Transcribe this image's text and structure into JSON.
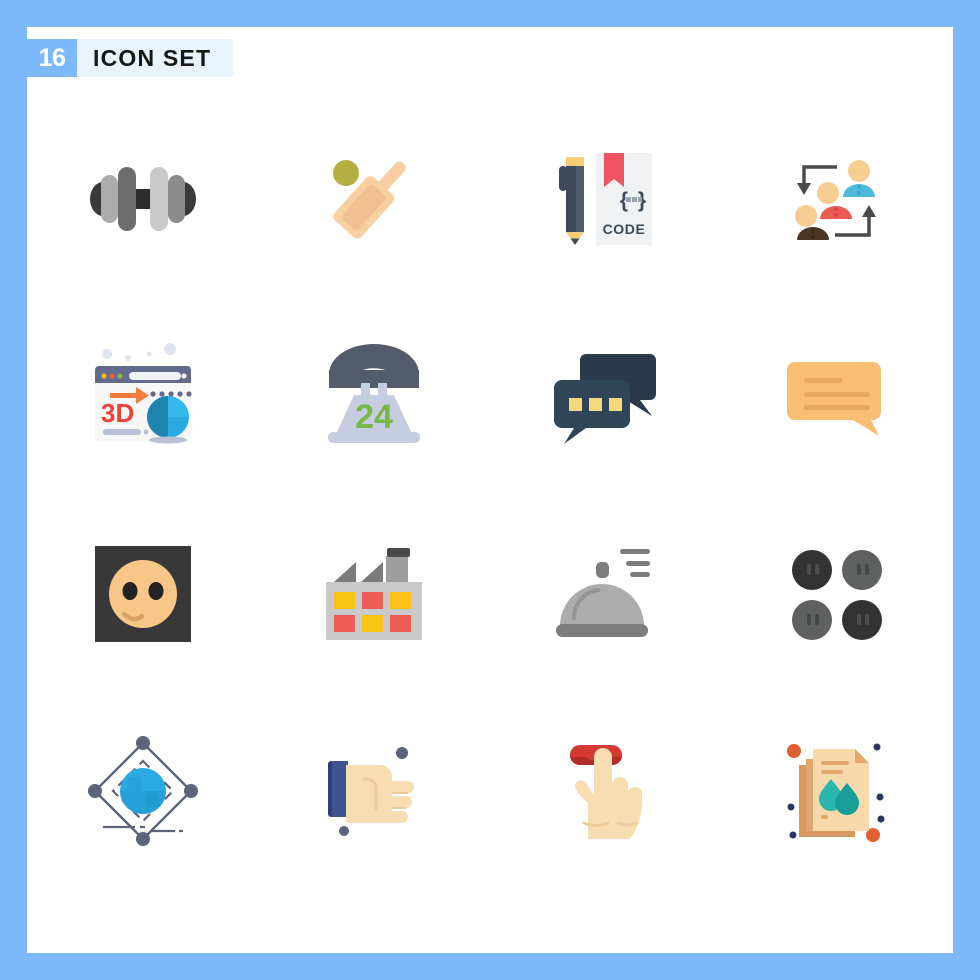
{
  "page": {
    "background_color": "#7db8fb",
    "canvas_color": "#ffffff"
  },
  "header": {
    "count": "16",
    "title": "ICON SET",
    "count_bg": "#7db8fb",
    "title_bg": "#eaf3fd",
    "count_color": "#ffffff",
    "title_color": "#161616"
  },
  "grid": {
    "columns": 4,
    "rows": 4,
    "total_icons": 16
  },
  "icons": [
    {
      "index": 1,
      "name": "dumbbell",
      "label": "Dumbbell",
      "colors": [
        "#3a3a3a",
        "#6e6e6e",
        "#a8a8a8",
        "#c9c9c9"
      ]
    },
    {
      "index": 2,
      "name": "cricket-bat",
      "label": "Cricket Bat and Ball",
      "colors": [
        "#f8cfa0",
        "#f5be82",
        "#b5ae42"
      ]
    },
    {
      "index": 3,
      "name": "coding-book",
      "label": "Code Book and Pen",
      "text": "CODE",
      "braces": "{...}",
      "colors": [
        "#3e4a5a",
        "#f0f1f3",
        "#ef5261",
        "#f4cf78"
      ]
    },
    {
      "index": 4,
      "name": "team-hierarchy",
      "label": "Team Hierarchy",
      "colors": [
        "#4cbadd",
        "#ea5a52",
        "#4c3524",
        "#f8cd92",
        "#4a4a4a"
      ]
    },
    {
      "index": 5,
      "name": "three-d-web",
      "label": "3D Web Browser",
      "text": "3D",
      "colors": [
        "#f7f7f7",
        "#646a8c",
        "#ef4136",
        "#f07c3e",
        "#1d85b0",
        "#29abe2"
      ]
    },
    {
      "index": 6,
      "name": "support-24-phone",
      "label": "24 Hour Phone Support",
      "text": "24",
      "colors": [
        "#545b6b",
        "#c6cde0",
        "#7ab648"
      ]
    },
    {
      "index": 7,
      "name": "chat-bubbles",
      "label": "Chat Conversation",
      "colors": [
        "#2b3a4a",
        "#314558",
        "#f6d87d"
      ]
    },
    {
      "index": 8,
      "name": "message-bubble",
      "label": "Message Bubble",
      "colors": [
        "#f9bd74",
        "#e7a75e"
      ]
    },
    {
      "index": 9,
      "name": "smiley-face",
      "label": "Emoji Face",
      "colors": [
        "#383838",
        "#f8c686",
        "#232323",
        "#d9a263"
      ]
    },
    {
      "index": 10,
      "name": "factory",
      "label": "Factory",
      "colors": [
        "#c9c9c9",
        "#7b7b7b",
        "#4a4a4a",
        "#fbc316",
        "#ef5b55"
      ]
    },
    {
      "index": 11,
      "name": "food-cloche",
      "label": "Food Serving Dome",
      "colors": [
        "#acacac",
        "#7d7d7d",
        "#949494"
      ]
    },
    {
      "index": 12,
      "name": "four-dots",
      "label": "Four Buttons",
      "colors": [
        "#333333",
        "#5f6060"
      ]
    },
    {
      "index": 13,
      "name": "network-globe",
      "label": "Network Globe",
      "colors": [
        "#5b6478",
        "#29abe2",
        "#1f8fc4"
      ]
    },
    {
      "index": 14,
      "name": "hand-gesture",
      "label": "Hand Gesture",
      "colors": [
        "#f8ddb2",
        "#3f5490",
        "#5b6478"
      ]
    },
    {
      "index": 15,
      "name": "press-button",
      "label": "Finger Pressing Button",
      "colors": [
        "#f8ddb2",
        "#d43a34",
        "#b32b27"
      ]
    },
    {
      "index": 16,
      "name": "water-documents",
      "label": "Water Documents",
      "colors": [
        "#f8d9ab",
        "#e0a86f",
        "#29b6ae",
        "#1a9e9a",
        "#e25f30",
        "#2a3560"
      ]
    }
  ]
}
